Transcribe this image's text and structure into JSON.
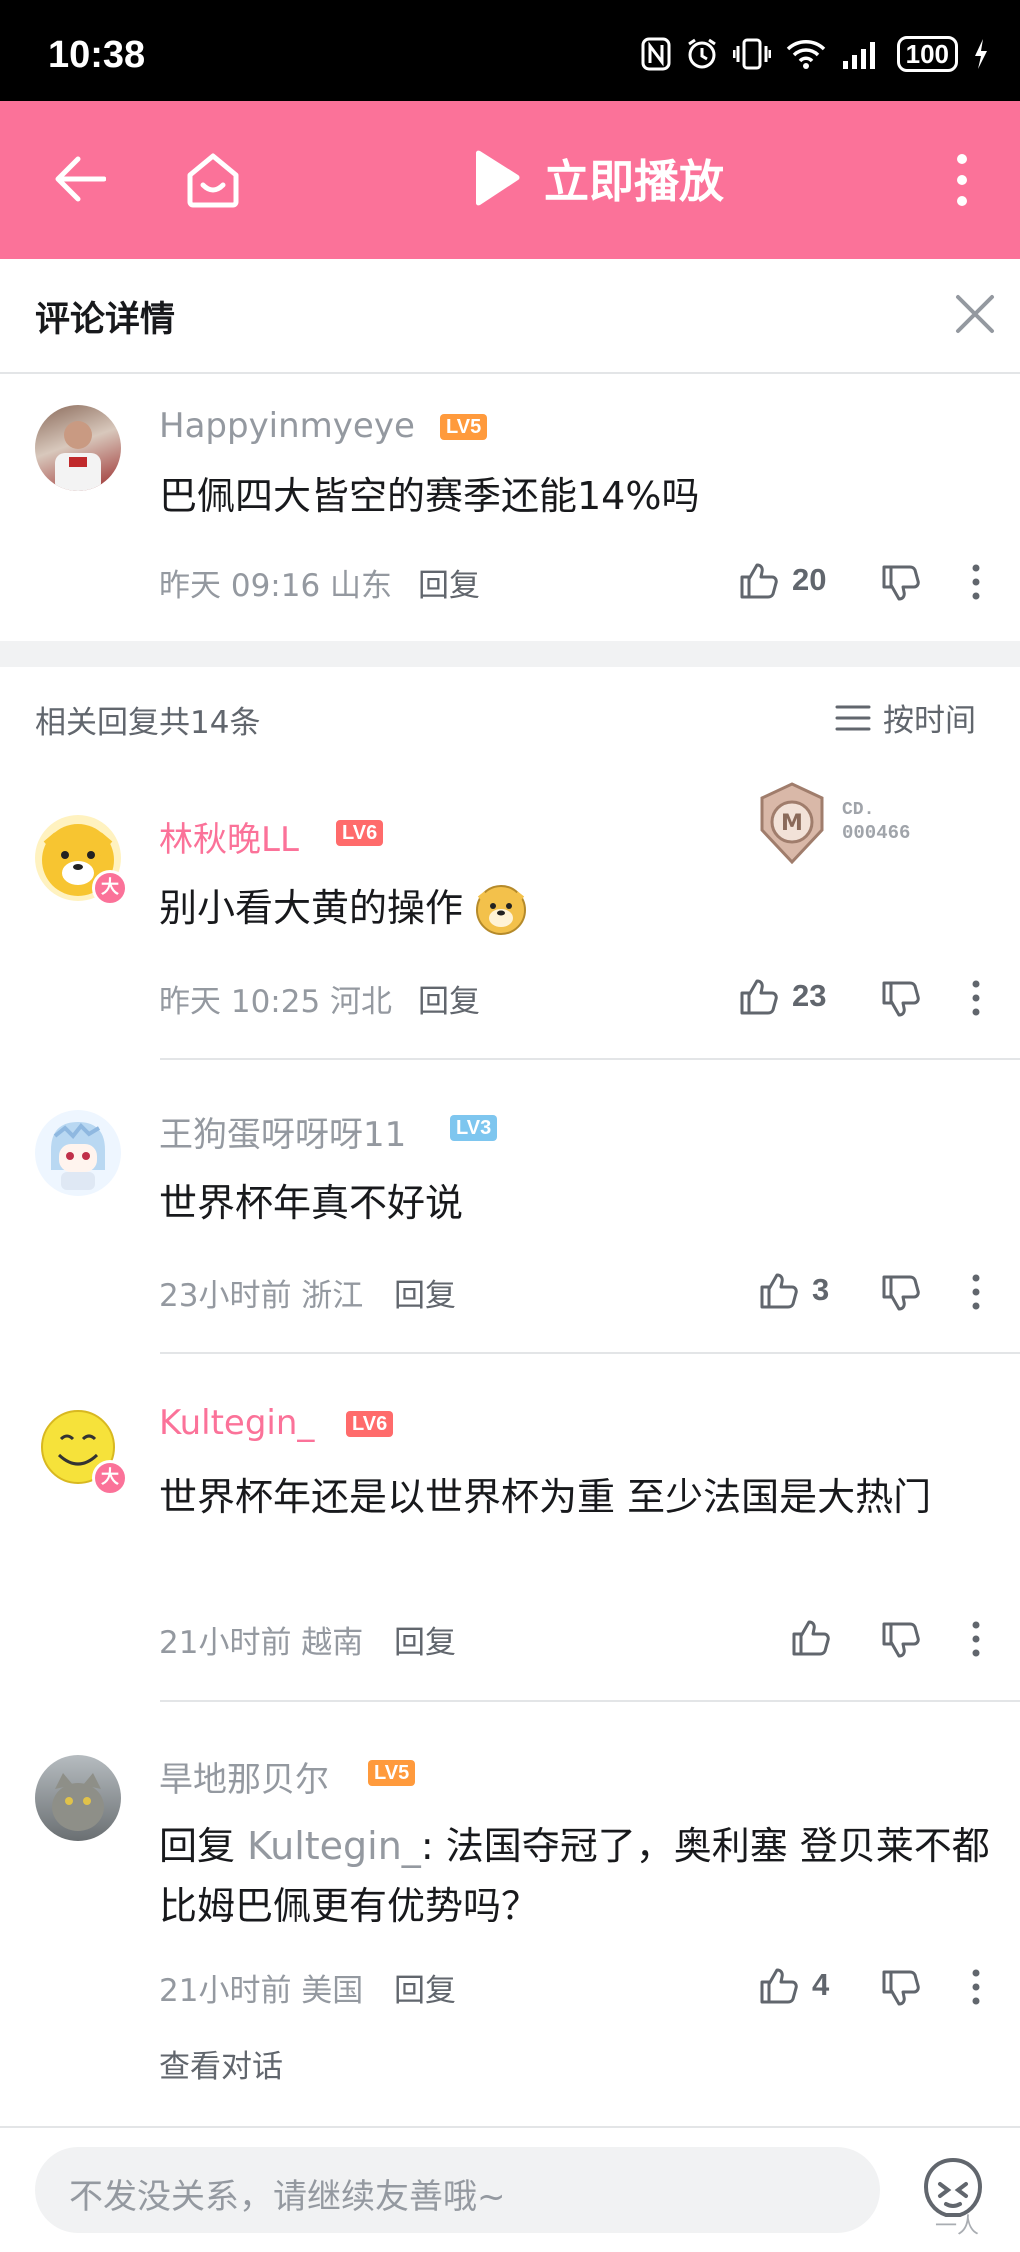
{
  "status_bar": {
    "time": "10:38",
    "battery": "100"
  },
  "top_bar": {
    "play_label": "立即播放",
    "accent_color": "#fb7299"
  },
  "detail": {
    "title": "评论详情"
  },
  "main_comment": {
    "user": "Happyinmyeye",
    "level": "LV5",
    "text": "巴佩四大皆空的赛季还能14%吗",
    "meta": "昨天 09:16 山东",
    "reply_label": "回复",
    "likes": "20"
  },
  "replies_header": {
    "count_label": "相关回复共14条",
    "sort_label": "按时间"
  },
  "replies": [
    {
      "user": "林秋晚LL",
      "level": "LV6",
      "text": "别小看大黄的操作",
      "meta": "昨天 10:25 河北",
      "reply_label": "回复",
      "likes": "23",
      "badge_label": "CD.",
      "badge_number": "000466",
      "vip_mark": "大"
    },
    {
      "user": "王狗蛋呀呀呀11",
      "level": "LV3",
      "text": "世界杯年真不好说",
      "meta": "23小时前 浙江",
      "reply_label": "回复",
      "likes": "3"
    },
    {
      "user": "Kultegin_",
      "level": "LV6",
      "text": "世界杯年还是以世界杯为重  至少法国是大热门",
      "meta": "21小时前 越南",
      "reply_label": "回复",
      "likes": "",
      "vip_mark": "大"
    },
    {
      "user": "旱地那贝尔",
      "level": "LV5",
      "text_prefix": "回复 ",
      "mention": "Kultegin_",
      "text": ": 法国夺冠了，奥利塞 登贝莱不都比姆巴佩更有优势吗？",
      "meta": "21小时前 美国",
      "reply_label": "回复",
      "likes": "4",
      "view_conversation": "查看对话"
    }
  ],
  "bottom_bar": {
    "placeholder": "不发没关系，请继续友善哦~",
    "watermark": "一人"
  }
}
